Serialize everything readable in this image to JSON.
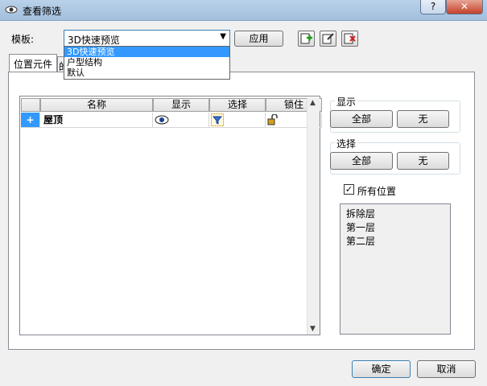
{
  "window": {
    "title": "查看筛选",
    "help_label": "?",
    "close_label": "✕"
  },
  "template": {
    "label": "模板:",
    "selected": "3D快速预览",
    "options": [
      "3D快速预览",
      "户型结构",
      "默认"
    ],
    "apply_label": "应用"
  },
  "tabs": [
    "位置元件",
    "的"
  ],
  "grid": {
    "columns": [
      "名称",
      "显示",
      "选择",
      "锁住"
    ],
    "rows": [
      {
        "expander": "+",
        "name": "屋顶",
        "display_icon": "eye-icon",
        "select_icon": "filter-icon",
        "lock_icon": "unlock-icon"
      }
    ]
  },
  "display_group": {
    "title": "显示",
    "all_label": "全部",
    "none_label": "无"
  },
  "select_group": {
    "title": "选择",
    "all_label": "全部",
    "none_label": "无"
  },
  "all_locations": {
    "label": "所有位置",
    "checked": true
  },
  "locations": [
    "拆除层",
    "第一层",
    "第二层"
  ],
  "footer": {
    "ok_label": "确定",
    "cancel_label": "取消"
  }
}
